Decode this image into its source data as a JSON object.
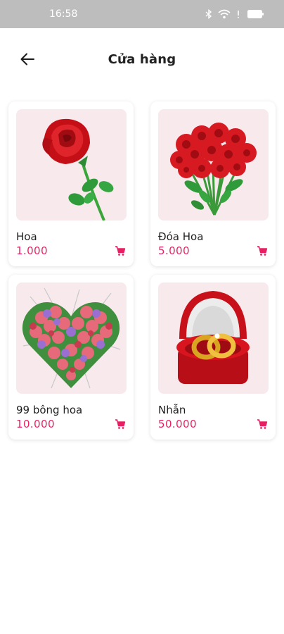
{
  "status_bar": {
    "time": "16:58"
  },
  "header": {
    "title": "Cửa hàng"
  },
  "products": [
    {
      "name": "Hoa",
      "price": "1.000",
      "image": "single-rose"
    },
    {
      "name": "Đóa Hoa",
      "price": "5.000",
      "image": "rose-bouquet"
    },
    {
      "name": "99 bông hoa",
      "price": "10.000",
      "image": "heart-flowers"
    },
    {
      "name": "Nhẫn",
      "price": "50.000",
      "image": "ring-box"
    }
  ],
  "colors": {
    "accent": "#e91e63",
    "thumb_bg": "#f8e9ec",
    "status_bar": "#bdbdbd"
  },
  "icons": {
    "back": "arrow-left-icon",
    "cart": "cart-icon"
  }
}
